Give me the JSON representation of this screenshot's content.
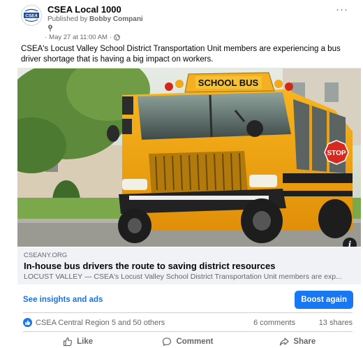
{
  "post": {
    "page_name": "CSEA Local 1000",
    "published_prefix": "Published by",
    "publisher": "Bobby Compani",
    "date": "May 27 at 11:00 AM",
    "separator": "·",
    "more_glyph": "···",
    "text": "CSEA's Locust Valley School District Transportation Unit members are experiencing a bus driver shortage that is having a big impact on workers.",
    "avatar_text": "CSEA"
  },
  "link": {
    "domain": "CSEANY.ORG",
    "title": "In-house bus drivers the route to saving district resources",
    "description": "LOCUST VALLEY — CSEA's Locust Valley School District Transportation Unit members are exp...",
    "bus_sign": "SCHOOL BUS",
    "stop_sign": "STOP",
    "info_glyph": "i"
  },
  "insights": {
    "link_label": "See insights and ads",
    "boost_label": "Boost again"
  },
  "reactions": {
    "names": "CSEA Central Region 5 and 50 others",
    "comments": "6 comments",
    "shares": "13 shares"
  },
  "actions": {
    "like": "Like",
    "comment": "Comment",
    "share": "Share"
  },
  "colors": {
    "accent": "#1877f2",
    "link_text": "#1b74e4",
    "secondary_text": "#65676b",
    "bus_yellow": "#f3a614"
  },
  "icons": [
    "more-icon",
    "pin-icon",
    "globe-icon",
    "info-icon",
    "like-reaction-icon",
    "like-icon",
    "comment-icon",
    "share-icon"
  ]
}
